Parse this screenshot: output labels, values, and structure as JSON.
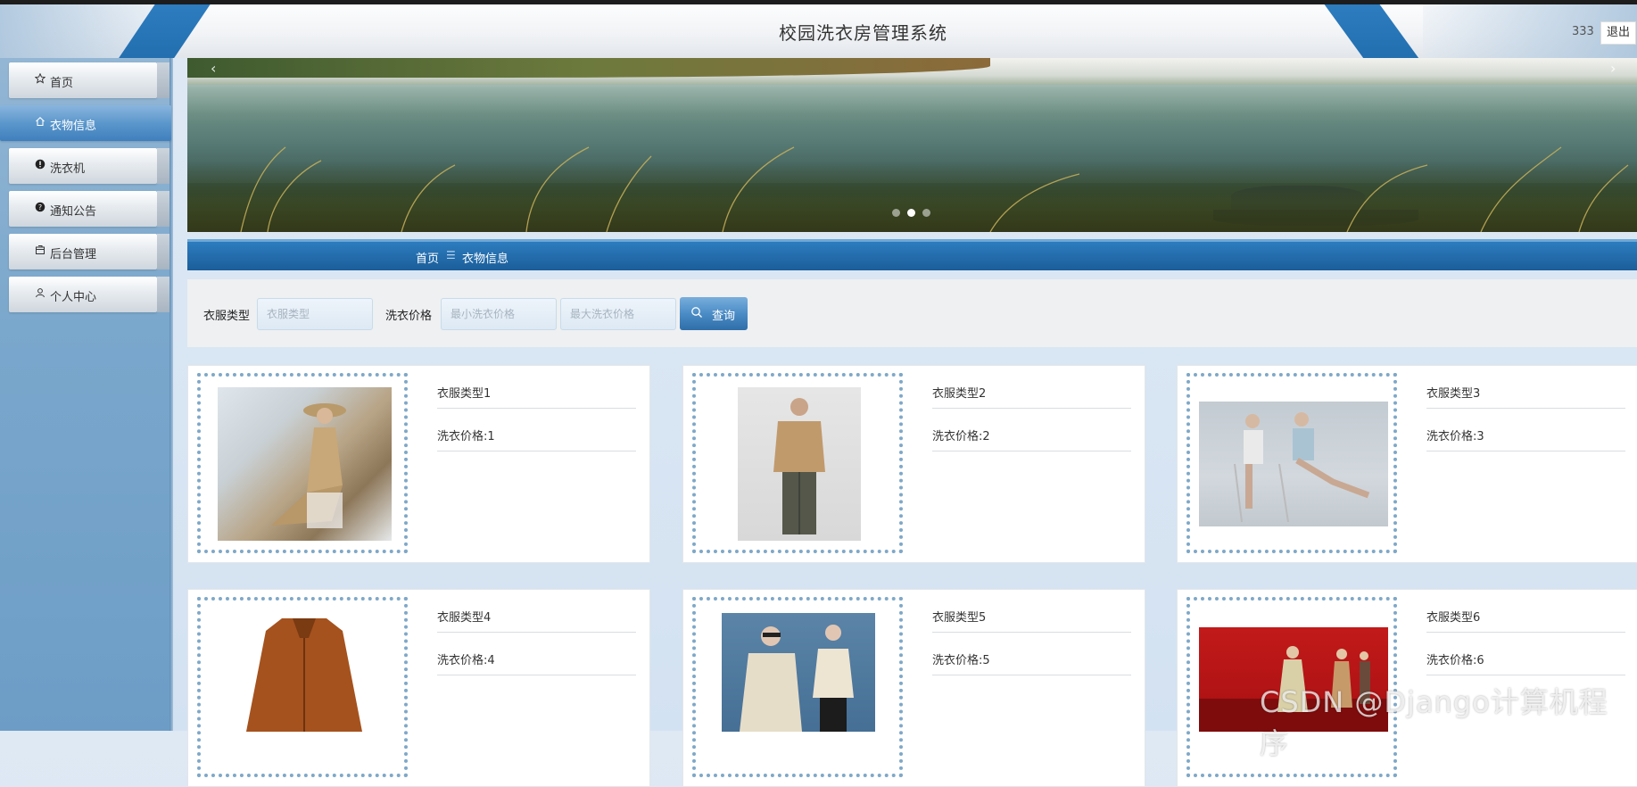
{
  "header": {
    "title": "校园洗衣房管理系统",
    "username": "333",
    "logout_label": "退出"
  },
  "sidebar": {
    "items": [
      {
        "label": "首页",
        "icon": "star-icon"
      },
      {
        "label": "衣物信息",
        "icon": "home-icon",
        "active": true
      },
      {
        "label": "洗衣机",
        "icon": "info-icon"
      },
      {
        "label": "通知公告",
        "icon": "question-icon"
      },
      {
        "label": "后台管理",
        "icon": "box-icon"
      },
      {
        "label": "个人中心",
        "icon": "user-icon"
      }
    ]
  },
  "banner": {
    "prev_arrow": "‹",
    "next_arrow": "›",
    "slide_count": 3,
    "active_slide": 2
  },
  "breadcrumb": {
    "home": "首页",
    "separator": "☰",
    "current": "衣物信息"
  },
  "search": {
    "type_label": "衣服类型",
    "type_placeholder": "衣服类型",
    "price_label": "洗衣价格",
    "min_placeholder": "最小洗衣价格",
    "max_placeholder": "最大洗衣价格",
    "button_label": "查询"
  },
  "cards": [
    {
      "type": "衣服类型1",
      "price": "洗衣价格:1"
    },
    {
      "type": "衣服类型2",
      "price": "洗衣价格:2"
    },
    {
      "type": "衣服类型3",
      "price": "洗衣价格:3"
    },
    {
      "type": "衣服类型4",
      "price": "洗衣价格:4"
    },
    {
      "type": "衣服类型5",
      "price": "洗衣价格:5"
    },
    {
      "type": "衣服类型6",
      "price": "洗衣价格:6"
    }
  ],
  "watermark": "CSDN @Django计算机程序",
  "colors": {
    "accent": "#2d7cbf",
    "accent_dark": "#1b5e9a",
    "sidebar": "#7aa7cc",
    "frame_dots": "#7fa8c8"
  }
}
